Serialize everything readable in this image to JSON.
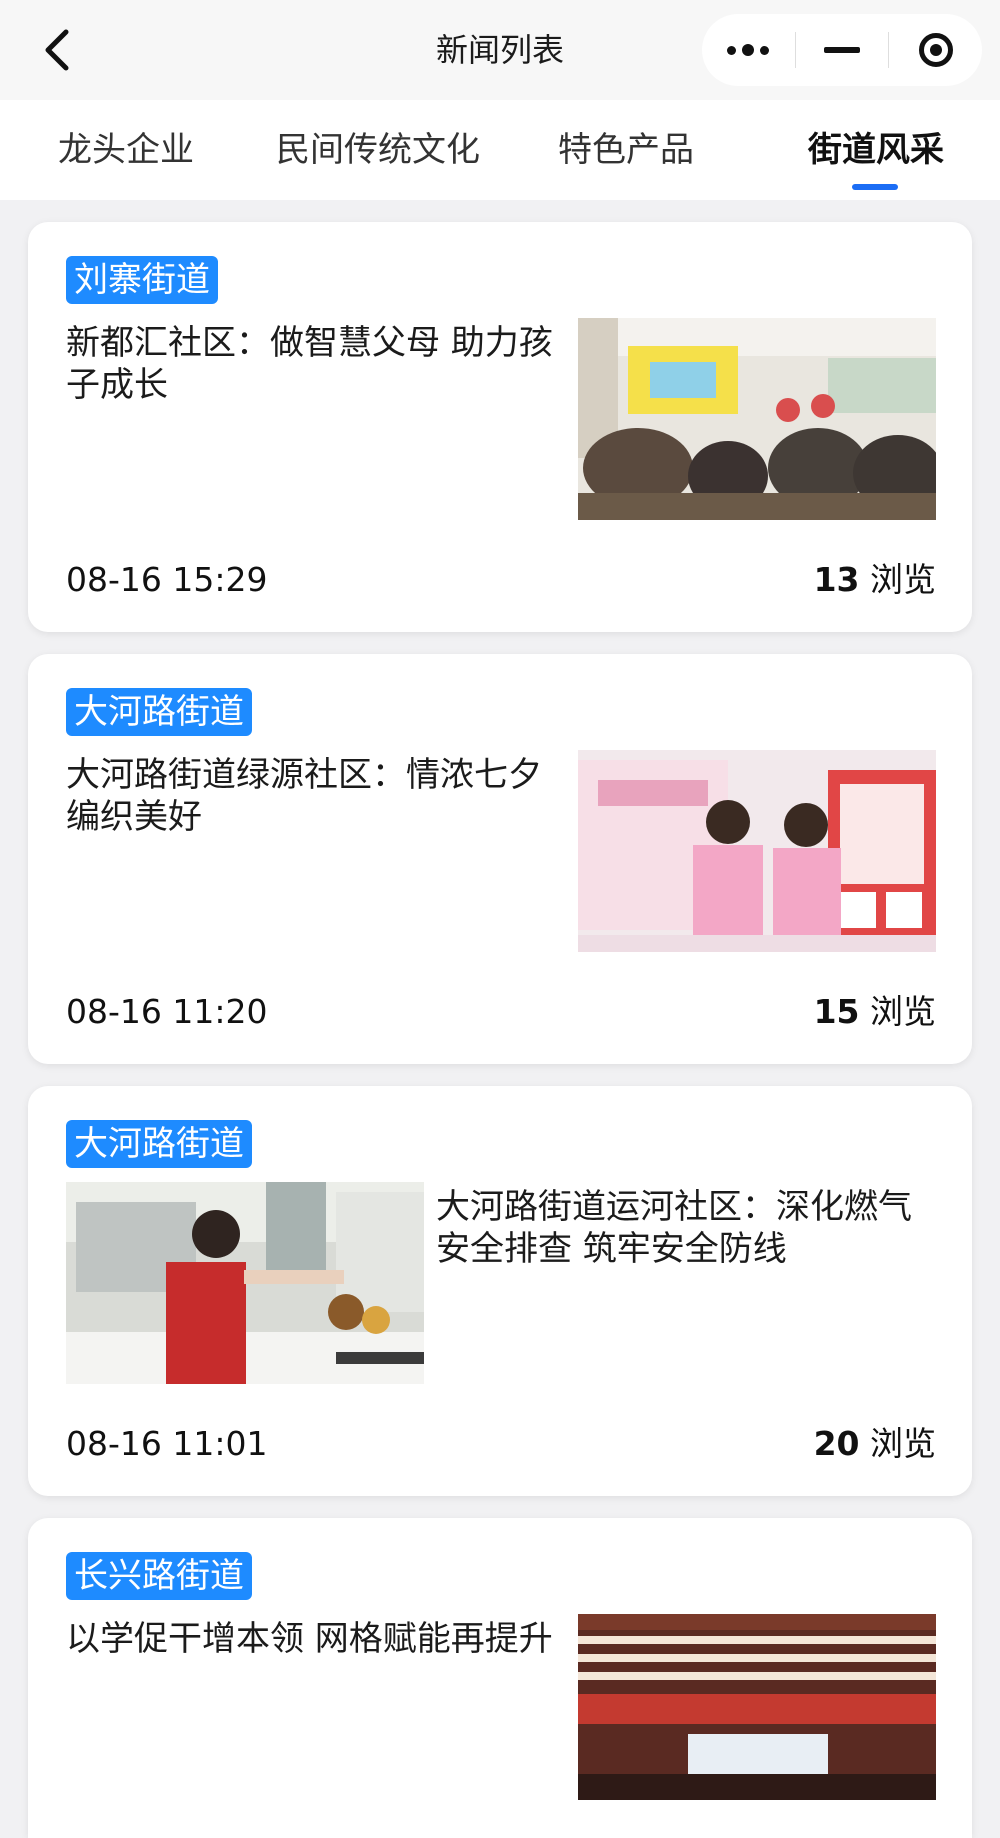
{
  "nav": {
    "title": "新闻列表",
    "back_icon": "chevron-left-icon",
    "capsule_icons": [
      "more-dots-icon",
      "minimize-icon",
      "close-target-icon"
    ]
  },
  "tabs": [
    {
      "label": "龙头企业",
      "active": false
    },
    {
      "label": "民间传统文化",
      "active": false
    },
    {
      "label": "特色产品",
      "active": false
    },
    {
      "label": "街道风采",
      "active": true
    }
  ],
  "accent_color": "#1b6df5",
  "tag_color": "#1e8bff",
  "articles": [
    {
      "tag": "刘寨街道",
      "title": "新都汇社区：做智慧父母 助力孩子成长",
      "time": "08-16 15:29",
      "views": "13",
      "views_label": "浏览",
      "image_side": "right"
    },
    {
      "tag": "大河路街道",
      "title": "大河路街道绿源社区：情浓七夕 编织美好",
      "time": "08-16 11:20",
      "views": "15",
      "views_label": "浏览",
      "image_side": "right"
    },
    {
      "tag": "大河路街道",
      "title": "大河路街道运河社区：深化燃气安全排查 筑牢安全防线",
      "time": "08-16 11:01",
      "views": "20",
      "views_label": "浏览",
      "image_side": "left"
    },
    {
      "tag": "长兴路街道",
      "title": "以学促干增本领 网格赋能再提升",
      "time": "",
      "views": "",
      "views_label": "",
      "image_side": "right"
    }
  ]
}
